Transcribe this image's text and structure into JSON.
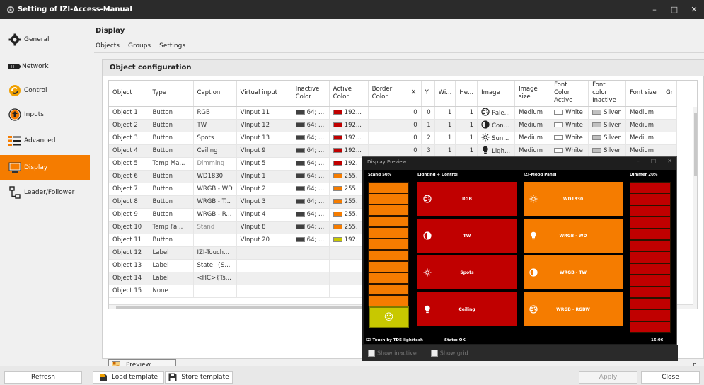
{
  "window": {
    "title": "Setting of IZI-Access-Manual",
    "min": "–",
    "max": "□",
    "close": "✕"
  },
  "sidebar": [
    {
      "label": "General",
      "icon": "gear-icon",
      "active": false
    },
    {
      "label": "Network",
      "icon": "network-card-icon",
      "active": false
    },
    {
      "label": "Control",
      "icon": "control-icon",
      "active": false
    },
    {
      "label": "Inputs",
      "icon": "arrow-up-circle-icon",
      "active": false
    },
    {
      "label": "Advanced",
      "icon": "list-settings-icon",
      "active": false
    },
    {
      "label": "Display",
      "icon": "monitor-icon",
      "active": true
    },
    {
      "label": "Leader/Follower",
      "icon": "hierarchy-icon",
      "active": false
    }
  ],
  "main": {
    "title": "Display",
    "tabs": [
      "Objects",
      "Groups",
      "Settings"
    ],
    "panel_title": "Object configuration",
    "columns": [
      "Object",
      "Type",
      "Caption",
      "Virtual input",
      "Inactive Color",
      "Active Color",
      "Border Color",
      "X",
      "Y",
      "Wi...",
      "He...",
      "Image",
      "Image size",
      "Font Color Active",
      "Font color Inactive",
      "Font size",
      "Gr"
    ],
    "rows": [
      {
        "object": "Object 1",
        "type": "Button",
        "caption": "RGB",
        "vinput": "VInput 11",
        "inactive": "64; ...",
        "active": "192...",
        "active_color": "#c00000",
        "x": "0",
        "y": "0",
        "w": "1",
        "h": "1",
        "image": "Pale...",
        "image_icon": "palette-icon",
        "isize": "Medium",
        "fca": "White",
        "fci": "Silver",
        "fsize": "Medium"
      },
      {
        "object": "Object 2",
        "type": "Button",
        "caption": "TW",
        "vinput": "VInput 12",
        "inactive": "64; ...",
        "active": "192...",
        "active_color": "#c00000",
        "x": "0",
        "y": "1",
        "w": "1",
        "h": "1",
        "image": "Con...",
        "image_icon": "contrast-icon",
        "isize": "Medium",
        "fca": "White",
        "fci": "Silver",
        "fsize": "Medium"
      },
      {
        "object": "Object 3",
        "type": "Button",
        "caption": "Spots",
        "vinput": "VInput 13",
        "inactive": "64; ...",
        "active": "192...",
        "active_color": "#c00000",
        "x": "0",
        "y": "2",
        "w": "1",
        "h": "1",
        "image": "Sun...",
        "image_icon": "sun-icon",
        "isize": "Medium",
        "fca": "White",
        "fci": "Silver",
        "fsize": "Medium"
      },
      {
        "object": "Object 4",
        "type": "Button",
        "caption": "Ceiling",
        "vinput": "VInput 9",
        "inactive": "64; ...",
        "active": "192...",
        "active_color": "#c00000",
        "x": "0",
        "y": "3",
        "w": "1",
        "h": "1",
        "image": "Ligh...",
        "image_icon": "light-bulb-icon",
        "isize": "Medium",
        "fca": "White",
        "fci": "Silver",
        "fsize": "Medium"
      },
      {
        "object": "Object 5",
        "type": "Temp Ma...",
        "caption": "Dimming",
        "caption_dim": true,
        "vinput": "VInput 5",
        "inactive": "64; ...",
        "active": "192.",
        "active_color": "#c00000"
      },
      {
        "object": "Object 6",
        "type": "Button",
        "caption": "WD1830",
        "vinput": "VInput 1",
        "inactive": "64; ...",
        "active": "255.",
        "active_color": "#f57c00"
      },
      {
        "object": "Object 7",
        "type": "Button",
        "caption": "WRGB - WD",
        "vinput": "VInput 2",
        "inactive": "64; ...",
        "active": "255.",
        "active_color": "#f57c00"
      },
      {
        "object": "Object 8",
        "type": "Button",
        "caption": "WRGB - T...",
        "vinput": "VInput 3",
        "inactive": "64; ...",
        "active": "255.",
        "active_color": "#f57c00"
      },
      {
        "object": "Object 9",
        "type": "Button",
        "caption": "WRGB - R...",
        "vinput": "VInput 4",
        "inactive": "64; ...",
        "active": "255.",
        "active_color": "#f57c00"
      },
      {
        "object": "Object 10",
        "type": "Temp Fa...",
        "caption": "Stand",
        "caption_dim": true,
        "vinput": "VInput 8",
        "inactive": "64; ...",
        "active": "255.",
        "active_color": "#f57c00"
      },
      {
        "object": "Object 11",
        "type": "Button",
        "caption": "",
        "vinput": "VInput 20",
        "inactive": "64; ...",
        "active": "192.",
        "active_color": "#c8c800"
      },
      {
        "object": "Object 12",
        "type": "Label",
        "caption": "IZI-Touch..."
      },
      {
        "object": "Object 13",
        "type": "Label",
        "caption": "State: {S..."
      },
      {
        "object": "Object 14",
        "type": "Label",
        "caption": "<HC>{Ts..."
      },
      {
        "object": "Object 15",
        "type": "None",
        "caption": ""
      }
    ],
    "inactive_color": "#404040",
    "preview_label": "Preview",
    "behind_text": "n"
  },
  "preview": {
    "title": "Display Preview",
    "min": "–",
    "max": "□",
    "close": "✕",
    "stand_header": "Stand  50%",
    "stand_level": 0.5,
    "smiley": "☺",
    "lighting_header": "Lighting + Control",
    "lighting_tiles": [
      {
        "label": "RGB",
        "icon": "palette-icon"
      },
      {
        "label": "TW",
        "icon": "contrast-icon"
      },
      {
        "label": "Spots",
        "icon": "sun-icon"
      },
      {
        "label": "Ceiling",
        "icon": "light-bulb-icon"
      }
    ],
    "mood_header": "IZI-Mood Panel",
    "mood_tiles": [
      {
        "label": "WD1830",
        "icon": "sun-icon"
      },
      {
        "label": "WRGB - WD",
        "icon": "light-bulb-icon"
      },
      {
        "label": "WRGB - TW",
        "icon": "contrast-icon"
      },
      {
        "label": "WRGB - RGBW",
        "icon": "palette-icon"
      }
    ],
    "dimmer_header": "Dimmer 20%",
    "dimmer_level": 0.2,
    "footer_left": "IZI-Touch by TDE-lighttech",
    "footer_state": "State: OK",
    "footer_time": "15:06",
    "show_inactive": "Show inactive",
    "show_grid": "Show grid"
  },
  "bottom": {
    "refresh": "Refresh",
    "load_template": "Load template",
    "store_template": "Store template",
    "apply": "Apply",
    "close": "Close"
  },
  "colors": {
    "accent": "#f57c00",
    "red": "#c00000"
  }
}
